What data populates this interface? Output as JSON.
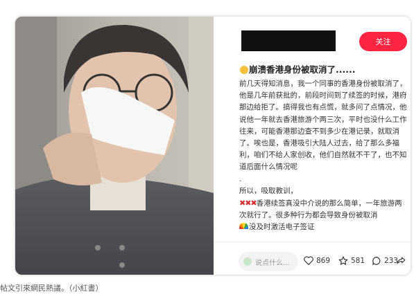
{
  "post": {
    "follow_label": "关注",
    "title": "崩溃香港身份被取消了......",
    "paragraph1": "前几天得知消息，我一个同事的香港身份被取消了，他是几年前获批的，前段时间到了续签的时候，港府那边给拒了。搞得我也有点慌，就多问了点情况，他说他一年就去香港旅游个两三次，平时也没什么工作往来，可能香港那边查不到多少在港记录，就取消了。唉也是，香港吸引大陆人过去，给了那么多福利，咱们不给人家创收，他们自然就不干了，也不知道后面什么情况呢",
    "dot": ".",
    "paragraph2": "所以，吸取教训，",
    "paragraph3": "香港续签真没中介说的那么简单，一年旅游两次就行了。很多种行为都会导致身份被取消",
    "paragraph4": "没及时激活电子签证",
    "x_marks": "✖✖✖"
  },
  "footer": {
    "comment_placeholder": "说点什么...",
    "likes": "869",
    "stars": "581",
    "comments": "233"
  },
  "caption": "帖文引來網民熱議。（小紅書）",
  "colors": {
    "accent": "#ff2442"
  },
  "icons": [
    "heart-icon",
    "star-icon",
    "comment-icon",
    "share-icon",
    "pencil-icon",
    "crying-emoji-icon",
    "rainbow-emoji-icon"
  ]
}
